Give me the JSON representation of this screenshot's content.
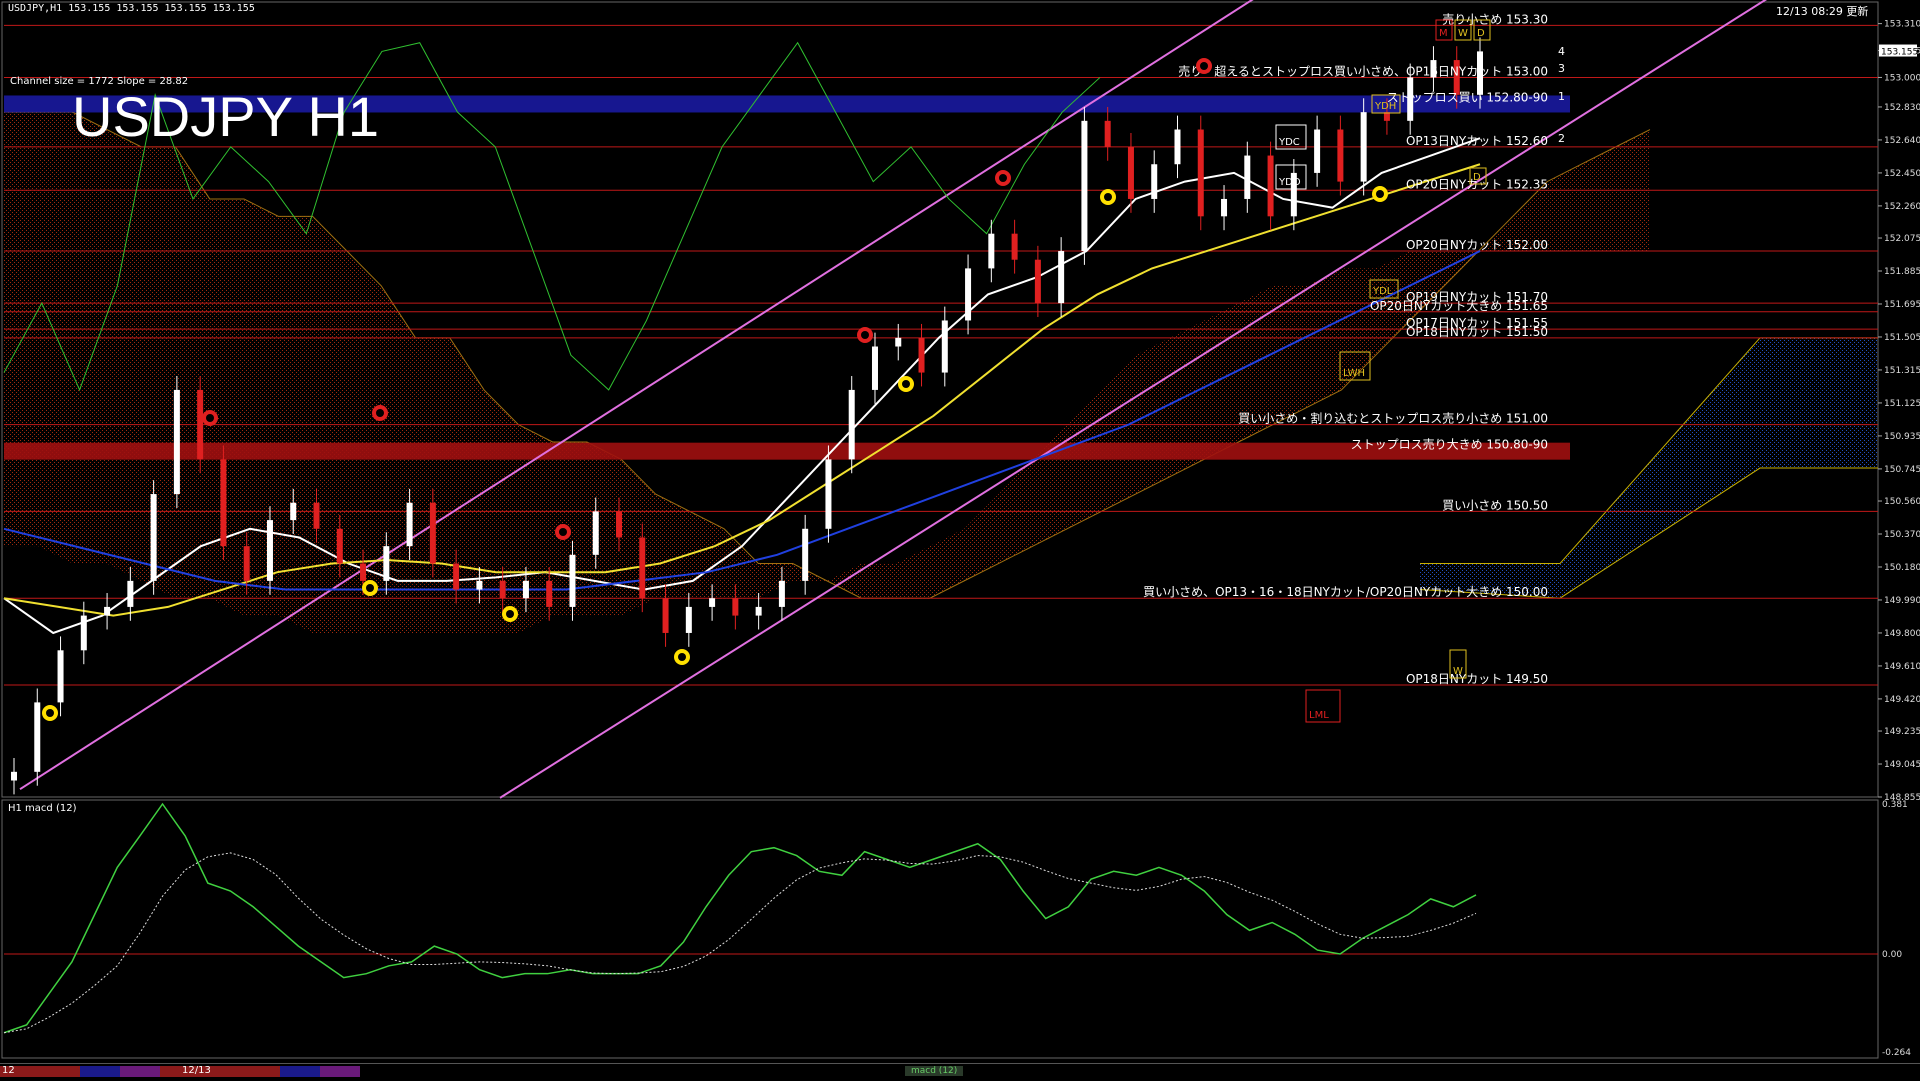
{
  "header": {
    "symbol_line": "USDJPY,H1  153.155 153.155 153.155 153.155",
    "timestamp": "12/13 08:29 更新",
    "big_title": "USDJPY H1",
    "channel_info": "Channel size = 1772 Slope = 28.82",
    "current_price": "153.155"
  },
  "price_axis": {
    "labels": [
      "153.310",
      "153.155",
      "153.000",
      "152.830",
      "152.640",
      "152.450",
      "152.260",
      "152.075",
      "151.885",
      "151.695",
      "151.505",
      "151.315",
      "151.125",
      "150.935",
      "150.745",
      "150.560",
      "150.370",
      "150.180",
      "149.990",
      "149.800",
      "149.610",
      "149.420",
      "149.235",
      "149.045",
      "148.855"
    ]
  },
  "levels": [
    {
      "label": "売り小さめ 153.30",
      "price": 153.3,
      "color": "#d01010"
    },
    {
      "label": "売り・超えるとストップロス買い小さめ、OP16日NYカット 153.00",
      "price": 153.0,
      "color": "#d01010"
    },
    {
      "label": "ストップロス買い 152.80-90",
      "price": 152.85,
      "color": "#1a1aa0",
      "band": true
    },
    {
      "label": "OP13日NYカット 152.60",
      "price": 152.6,
      "color": "#d01010"
    },
    {
      "label": "OP20日NYカット 152.35",
      "price": 152.35,
      "color": "#d01010"
    },
    {
      "label": "OP20日NYカット 152.00",
      "price": 152.0,
      "color": "#d01010"
    },
    {
      "label": "OP19日NYカット 151.70",
      "price": 151.7,
      "color": "#d01010"
    },
    {
      "label": "OP20日NYカット大きめ 151.65",
      "price": 151.65,
      "color": "#d01010"
    },
    {
      "label": "OP17日NYカット 151.55",
      "price": 151.55,
      "color": "#d01010"
    },
    {
      "label": "OP18日NYカット 151.50",
      "price": 151.5,
      "color": "#d01010"
    },
    {
      "label": "買い小さめ・割り込むとストップロス売り小さめ 151.00",
      "price": 151.0,
      "color": "#d01010"
    },
    {
      "label": "ストップロス売り大きめ 150.80-90",
      "price": 150.85,
      "color": "#a01010",
      "band": true
    },
    {
      "label": "買い小さめ 150.50",
      "price": 150.5,
      "color": "#d01010"
    },
    {
      "label": "買い小さめ、OP13・16・18日NYカット/OP20日NYカット大きめ 150.00",
      "price": 150.0,
      "color": "#d01010"
    },
    {
      "label": "OP18日NYカット 149.50",
      "price": 149.5,
      "color": "#d01010"
    }
  ],
  "markers": {
    "ydc": "YDC",
    "ydo": "YDO",
    "ydh": "YDH",
    "ydl": "YDL",
    "lwh": "LWH",
    "lml": "LML",
    "w": "W",
    "d": "D",
    "m": "M",
    "channel_numbers": [
      "4",
      "3",
      "1",
      "2"
    ]
  },
  "macd": {
    "title": "H1  macd (12)",
    "axis_top": "0.381",
    "axis_zero": "0.00",
    "axis_bottom": "-0.264",
    "axis_end": "180000"
  },
  "bottom_bar": {
    "left_label": "12",
    "date_label": "12/13",
    "macd_tag": "macd (12)"
  },
  "chart_data": {
    "type": "line",
    "title": "USDJPY H1",
    "ylim": [
      148.855,
      153.4
    ],
    "series": [
      {
        "name": "price",
        "values": [
          149.0,
          149.4,
          149.7,
          149.9,
          149.95,
          150.1,
          150.6,
          151.2,
          150.8,
          150.3,
          150.1,
          150.45,
          150.55,
          150.4,
          150.2,
          150.1,
          150.3,
          150.55,
          150.2,
          150.05,
          150.1,
          150.0,
          150.1,
          149.95,
          150.25,
          150.5,
          150.35,
          150.0,
          149.8,
          149.95,
          150.0,
          149.9,
          149.95,
          150.1,
          150.4,
          150.8,
          151.2,
          151.45,
          151.5,
          151.3,
          151.6,
          151.9,
          152.1,
          151.95,
          151.7,
          152.0,
          152.75,
          152.6,
          152.3,
          152.5,
          152.7,
          152.2,
          152.3,
          152.55,
          152.2,
          152.45,
          152.7,
          152.4,
          152.8,
          152.75,
          153.0,
          153.1,
          152.9,
          153.15
        ]
      }
    ]
  }
}
